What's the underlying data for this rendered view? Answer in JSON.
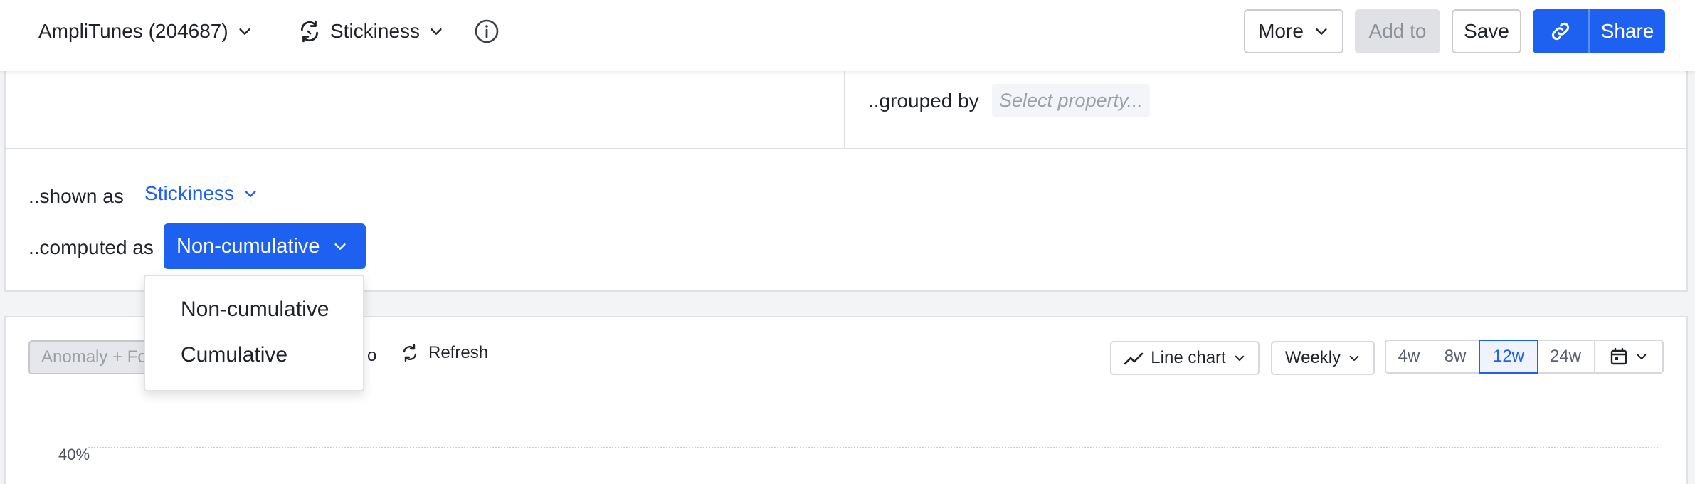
{
  "topbar": {
    "project_label": "AmpliTunes (204687)",
    "chart_type_label": "Stickiness",
    "more_label": "More",
    "add_to_label": "Add to",
    "save_label": "Save",
    "share_label": "Share"
  },
  "query": {
    "grouped_by_label": "..grouped by",
    "grouped_by_placeholder": "Select property...",
    "shown_as_label": "..shown as",
    "shown_as_value": "Stickiness",
    "computed_as_label": "..computed as",
    "computed_as_value": "Non-cumulative",
    "computed_as_options": [
      "Non-cumulative",
      "Cumulative"
    ]
  },
  "chart_toolbar": {
    "anomaly_label": "Anomaly + Fo",
    "partial_label": "o",
    "refresh_label": "Refresh",
    "chart_type_label": "Line chart",
    "interval_label": "Weekly",
    "ranges": [
      "4w",
      "8w",
      "12w",
      "24w"
    ],
    "selected_range": "12w"
  },
  "chart": {
    "y_tick_top": "40%"
  },
  "colors": {
    "accent": "#1e61f0",
    "border": "#dfe1e4"
  }
}
